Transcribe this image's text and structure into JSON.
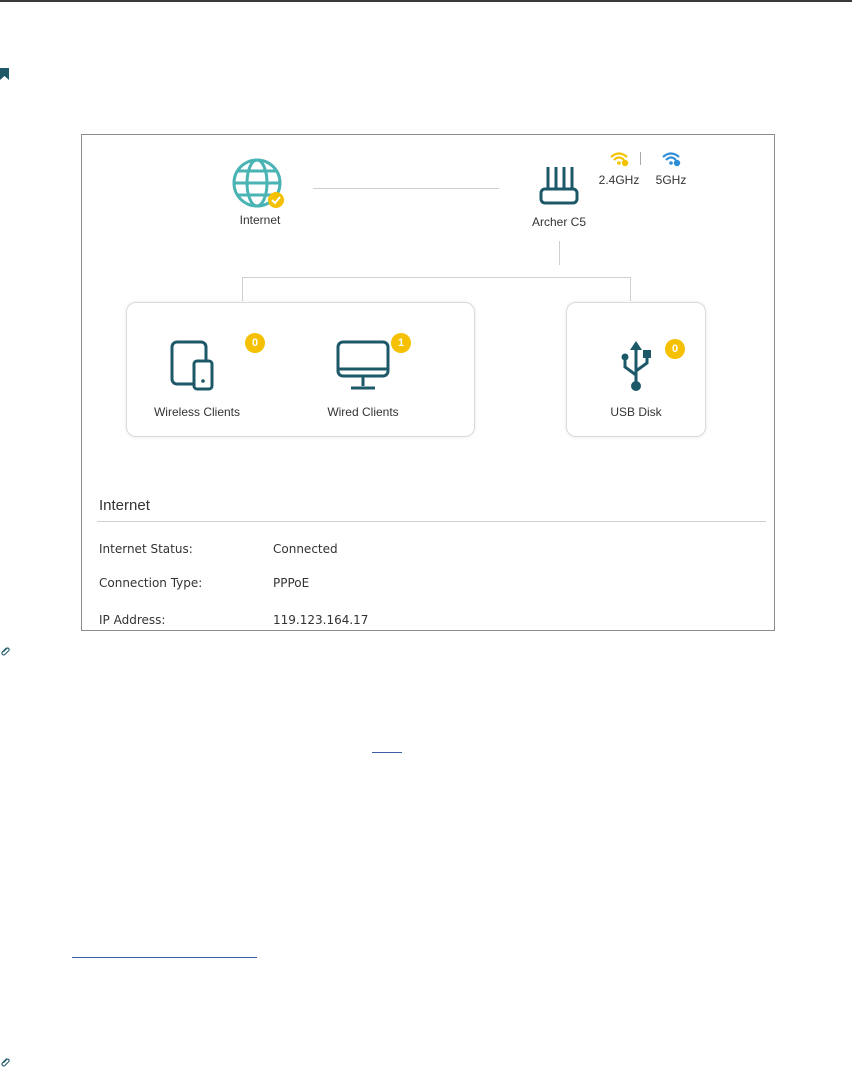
{
  "topology": {
    "internet_label": "Internet",
    "router_label": "Archer C5",
    "band_24_label": "2.4GHz",
    "band_5_label": "5GHz",
    "wireless_clients_label": "Wireless Clients",
    "wireless_clients_count": "0",
    "wired_clients_label": "Wired Clients",
    "wired_clients_count": "1",
    "usb_label": "USB Disk",
    "usb_count": "0"
  },
  "info": {
    "title": "Internet",
    "rows": [
      {
        "key": "Internet Status:",
        "value": "Connected"
      },
      {
        "key": "Connection Type:",
        "value": "PPPoE"
      },
      {
        "key": "IP Address:",
        "value": "119.123.164.17"
      }
    ]
  },
  "colors": {
    "accent_teal": "#4ab3b4",
    "icon_dark": "#1d5868",
    "badge_yellow": "#f5c000",
    "wifi_24_yellow": "#f3c300",
    "wifi_5_blue": "#2f8fd6",
    "link_blue": "#3a5fa8"
  }
}
